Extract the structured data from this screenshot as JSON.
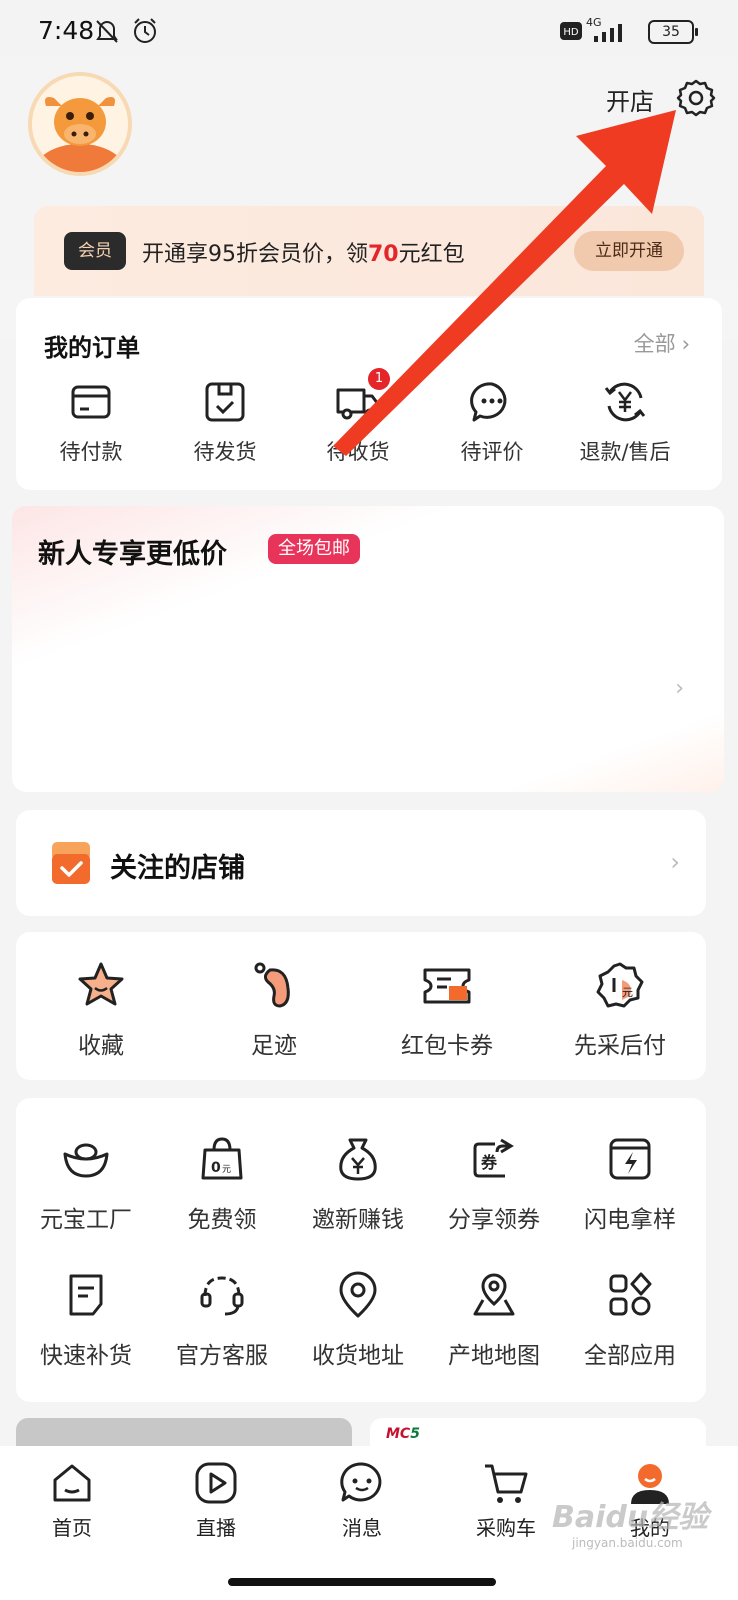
{
  "status_bar": {
    "time": "7:48",
    "network": "4G",
    "battery": "35"
  },
  "header": {
    "open_store": "开店"
  },
  "vip": {
    "badge": "会员",
    "text_prefix": "开通享95折会员价，领",
    "text_amount": "70",
    "text_suffix": "元红包",
    "button": "立即开通"
  },
  "orders": {
    "title": "我的订单",
    "all_label": "全部",
    "items": [
      {
        "label": "待付款",
        "icon": "wallet-card-icon"
      },
      {
        "label": "待发货",
        "icon": "box-check-icon"
      },
      {
        "label": "待收货",
        "icon": "truck-icon",
        "badge": "1"
      },
      {
        "label": "待评价",
        "icon": "chat-dots-icon"
      },
      {
        "label": "退款/售后",
        "icon": "refund-yen-icon"
      }
    ]
  },
  "new_user": {
    "title": "新人专享更低价",
    "tag": "全场包邮"
  },
  "followed_shops": {
    "title": "关注的店铺"
  },
  "quick_links": [
    {
      "label": "收藏",
      "icon": "star-icon"
    },
    {
      "label": "足迹",
      "icon": "footprint-icon"
    },
    {
      "label": "红包卡券",
      "icon": "coupon-icon"
    },
    {
      "label": "先采后付",
      "icon": "pay-later-icon"
    }
  ],
  "tools": [
    {
      "label": "元宝工厂",
      "icon": "ingot-icon"
    },
    {
      "label": "免费领",
      "icon": "free-bag-icon"
    },
    {
      "label": "邀新赚钱",
      "icon": "money-bag-icon"
    },
    {
      "label": "分享领券",
      "icon": "share-coupon-icon"
    },
    {
      "label": "闪电拿样",
      "icon": "lightning-sample-icon"
    },
    {
      "label": "快速补货",
      "icon": "restock-doc-icon"
    },
    {
      "label": "官方客服",
      "icon": "headset-icon"
    },
    {
      "label": "收货地址",
      "icon": "location-pin-icon"
    },
    {
      "label": "产地地图",
      "icon": "origin-map-icon"
    },
    {
      "label": "全部应用",
      "icon": "all-apps-icon"
    }
  ],
  "bottom_banner": {
    "brand_left": "MC",
    "brand_right": "5"
  },
  "tabbar": [
    {
      "label": "首页",
      "icon": "home-icon"
    },
    {
      "label": "直播",
      "icon": "live-play-icon"
    },
    {
      "label": "消息",
      "icon": "message-icon"
    },
    {
      "label": "采购车",
      "icon": "cart-icon"
    },
    {
      "label": "我的",
      "icon": "profile-icon",
      "active": true
    }
  ],
  "watermark": {
    "text": "Baidu经验",
    "sub": "jingyan.baidu.com"
  },
  "colors": {
    "accent_red": "#e4262a",
    "tag_pink": "#e8335a",
    "vip_bg": "#fbe6da",
    "arrow_red": "#ee3b22"
  }
}
